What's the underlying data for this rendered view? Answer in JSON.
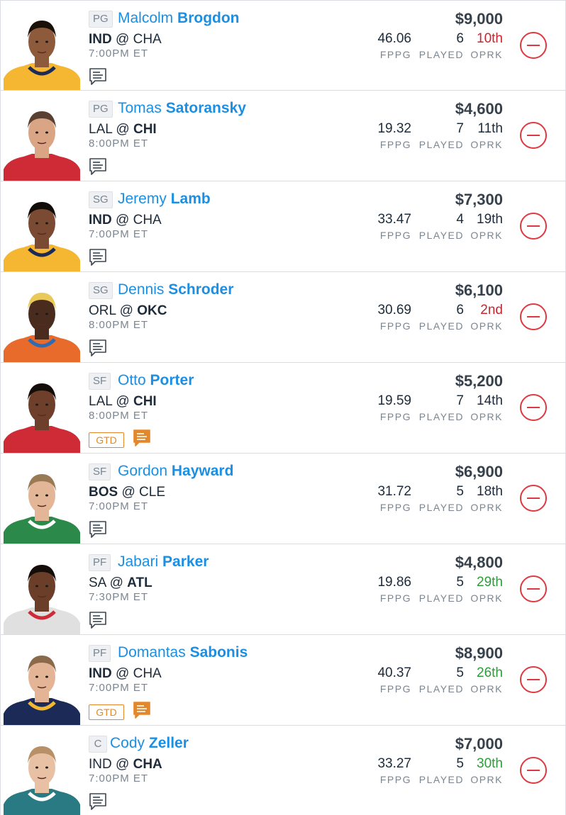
{
  "players": [
    {
      "pos": "PG",
      "first": "Malcolm",
      "last": "Brogdon",
      "away": "IND",
      "home": "CHA",
      "bold": "away",
      "time": "7:00PM ET",
      "fppg": "46.06",
      "played": "6",
      "oprk": "10th",
      "oprk_color": "red",
      "salary": "$9,000",
      "gtd": "",
      "jersey": "#f5b731",
      "jersey2": "#1b2a57",
      "skin": "#8d5a3c",
      "hair": "#1a1008"
    },
    {
      "pos": "PG",
      "first": "Tomas",
      "last": "Satoransky",
      "away": "LAL",
      "home": "CHI",
      "bold": "home",
      "time": "8:00PM ET",
      "fppg": "19.32",
      "played": "7",
      "oprk": "11th",
      "oprk_color": "dark",
      "salary": "$4,600",
      "gtd": "",
      "jersey": "#cf2b36",
      "jersey2": "#cf2b36",
      "skin": "#d9a585",
      "hair": "#5a4030"
    },
    {
      "pos": "SG",
      "first": "Jeremy",
      "last": "Lamb",
      "away": "IND",
      "home": "CHA",
      "bold": "away",
      "time": "7:00PM ET",
      "fppg": "33.47",
      "played": "4",
      "oprk": "19th",
      "oprk_color": "dark",
      "salary": "$7,300",
      "gtd": "",
      "jersey": "#f5b731",
      "jersey2": "#1b2a57",
      "skin": "#7a4a32",
      "hair": "#120c08"
    },
    {
      "pos": "SG",
      "first": "Dennis",
      "last": "Schroder",
      "away": "ORL",
      "home": "OKC",
      "bold": "home",
      "time": "8:00PM ET",
      "fppg": "30.69",
      "played": "6",
      "oprk": "2nd",
      "oprk_color": "red",
      "salary": "$6,100",
      "gtd": "",
      "jersey": "#e96b2c",
      "jersey2": "#2f6bb3",
      "skin": "#4a2c1e",
      "hair": "#e8c95a"
    },
    {
      "pos": "SF",
      "first": "Otto",
      "last": "Porter",
      "away": "LAL",
      "home": "CHI",
      "bold": "home",
      "time": "8:00PM ET",
      "fppg": "19.59",
      "played": "7",
      "oprk": "14th",
      "oprk_color": "dark",
      "salary": "$5,200",
      "gtd": "GTD",
      "jersey": "#cf2b36",
      "jersey2": "#cf2b36",
      "skin": "#6e402b",
      "hair": "#140d09"
    },
    {
      "pos": "SF",
      "first": "Gordon",
      "last": "Hayward",
      "away": "BOS",
      "home": "CLE",
      "bold": "away",
      "time": "7:00PM ET",
      "fppg": "31.72",
      "played": "5",
      "oprk": "18th",
      "oprk_color": "dark",
      "salary": "$6,900",
      "gtd": "",
      "jersey": "#2b8a4a",
      "jersey2": "#ffffff",
      "skin": "#e3b697",
      "hair": "#9a7a55"
    },
    {
      "pos": "PF",
      "first": "Jabari",
      "last": "Parker",
      "away": "SA",
      "home": "ATL",
      "bold": "home",
      "time": "7:30PM ET",
      "fppg": "19.86",
      "played": "5",
      "oprk": "29th",
      "oprk_color": "green",
      "salary": "$4,800",
      "gtd": "",
      "jersey": "#e0e0e0",
      "jersey2": "#cf2b36",
      "skin": "#6a3e29",
      "hair": "#140d09"
    },
    {
      "pos": "PF",
      "first": "Domantas",
      "last": "Sabonis",
      "away": "IND",
      "home": "CHA",
      "bold": "away",
      "time": "7:00PM ET",
      "fppg": "40.37",
      "played": "5",
      "oprk": "26th",
      "oprk_color": "green",
      "salary": "$8,900",
      "gtd": "GTD",
      "jersey": "#1b2a57",
      "jersey2": "#f5b731",
      "skin": "#e4b496",
      "hair": "#8a6a4a"
    },
    {
      "pos": "C",
      "first": "Cody",
      "last": "Zeller",
      "away": "IND",
      "home": "CHA",
      "bold": "home",
      "time": "7:00PM ET",
      "fppg": "33.27",
      "played": "5",
      "oprk": "30th",
      "oprk_color": "green",
      "salary": "$7,000",
      "gtd": "",
      "jersey": "#2a7a84",
      "jersey2": "#ffffff",
      "skin": "#e8c0a4",
      "hair": "#b89068"
    }
  ],
  "labels": {
    "fppg": "FPPG",
    "played": "PLAYED",
    "oprk": "OPRK",
    "at": "@"
  },
  "colors": {
    "name_blue": "#1a8fe3",
    "remove_red": "#e0383f",
    "gtd_orange": "#e3872b",
    "oprk_red": "#c8262d",
    "oprk_green": "#2e9c3a"
  },
  "icons": {
    "notes": "notes-icon",
    "notes_alert": "notes-alert-icon",
    "remove": "remove-player-icon"
  }
}
